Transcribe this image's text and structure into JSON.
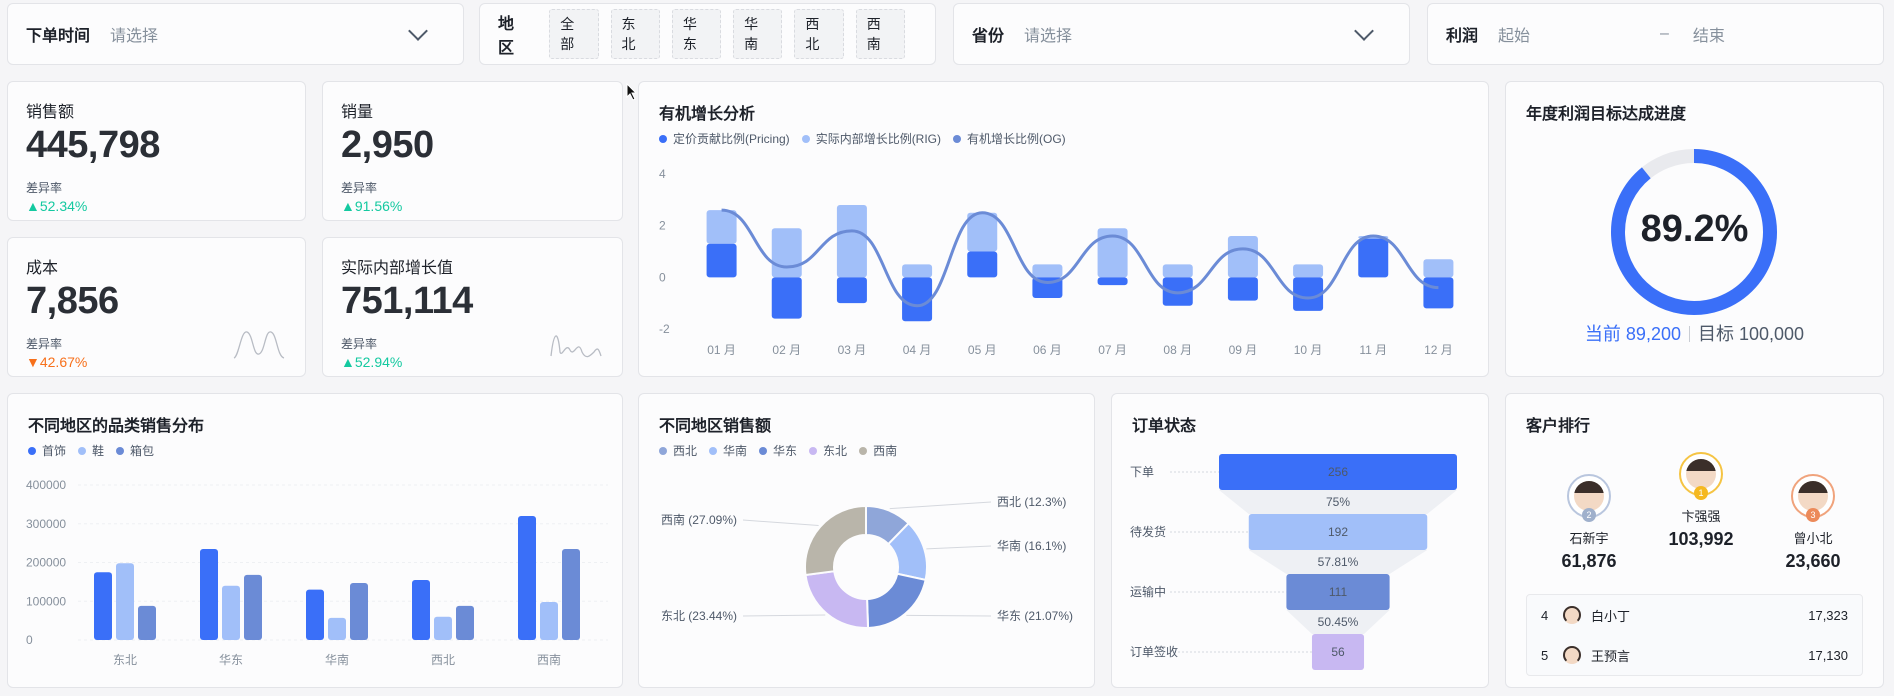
{
  "filters": {
    "order_time": {
      "label": "下单时间",
      "placeholder": "请选择"
    },
    "region": {
      "label": "地区",
      "tags": [
        "全部",
        "东北",
        "华东",
        "华南",
        "西北",
        "西南"
      ]
    },
    "province": {
      "label": "省份",
      "placeholder": "请选择"
    },
    "profit": {
      "label": "利润",
      "start": "起始",
      "sep": "–",
      "end": "结束"
    }
  },
  "kpis": [
    {
      "title": "销售额",
      "value": "445,798",
      "diff_label": "差异率",
      "delta": "52.34%",
      "trend": "up"
    },
    {
      "title": "销量",
      "value": "2,950",
      "diff_label": "差异率",
      "delta": "91.56%",
      "trend": "up"
    },
    {
      "title": "成本",
      "value": "7,856",
      "diff_label": "差异率",
      "delta": "42.67%",
      "trend": "down"
    },
    {
      "title": "实际内部增长值",
      "value": "751,114",
      "diff_label": "差异率",
      "delta": "52.94%",
      "trend": "up"
    }
  ],
  "colors": {
    "blue": "#3a6ff8",
    "light_blue": "#a1bff9",
    "slate_blue": "#6b8bd6",
    "lavender": "#c8b8f2",
    "gray": "#b9b5aa"
  },
  "growth": {
    "title": "有机增长分析",
    "legend": [
      {
        "label": "定价贡献比例(Pricing)",
        "color": "#3a6ff8"
      },
      {
        "label": "实际内部增长比例(RIG)",
        "color": "#a1bff9"
      },
      {
        "label": "有机增长比例(OG)",
        "color": "#6b8bd6"
      }
    ]
  },
  "gauge": {
    "title": "年度利润目标达成进度",
    "percent_text": "89.2%",
    "progress": 0.892,
    "current": "当前 89,200",
    "target": "目标 100,000"
  },
  "category": {
    "title": "不同地区的品类销售分布",
    "legend": [
      {
        "label": "首饰",
        "color": "#3a6ff8"
      },
      {
        "label": "鞋",
        "color": "#a1bff9"
      },
      {
        "label": "箱包",
        "color": "#6b8bd6"
      }
    ]
  },
  "region_sales": {
    "title": "不同地区销售额",
    "legend": [
      {
        "label": "西北",
        "color": "#8fa6d9"
      },
      {
        "label": "华南",
        "color": "#a1bff9"
      },
      {
        "label": "华东",
        "color": "#6b8bd6"
      },
      {
        "label": "东北",
        "color": "#c8b8f2"
      },
      {
        "label": "西南",
        "color": "#b9b5aa"
      }
    ]
  },
  "order_status": {
    "title": "订单状态"
  },
  "customers": {
    "title": "客户排行",
    "podium": [
      {
        "rank": "2",
        "name": "石新宇",
        "value": "61,876"
      },
      {
        "rank": "1",
        "name": "卞强强",
        "value": "103,992"
      },
      {
        "rank": "3",
        "name": "曾小北",
        "value": "23,660"
      }
    ],
    "list": [
      {
        "rank": "4",
        "name": "白小丁",
        "value": "17,323"
      },
      {
        "rank": "5",
        "name": "王预言",
        "value": "17,130"
      }
    ]
  },
  "chart_data": [
    {
      "type": "bar",
      "title": "有机增长分析",
      "categories": [
        "01 月",
        "02 月",
        "03 月",
        "04 月",
        "05 月",
        "06 月",
        "07 月",
        "08 月",
        "09 月",
        "10 月",
        "11 月",
        "12 月"
      ],
      "ylim": [
        -2,
        4
      ],
      "yticks": [
        "4",
        "2",
        "0",
        "-2"
      ],
      "series": [
        {
          "name": "定价贡献比例(Pricing)",
          "values": [
            1.3,
            -1.6,
            -1.0,
            -1.7,
            1.0,
            -0.8,
            -0.3,
            -1.1,
            -0.9,
            -1.3,
            1.5,
            -1.2
          ]
        },
        {
          "name": "实际内部增长比例(RIG)",
          "values": [
            1.3,
            1.9,
            2.8,
            0.5,
            1.5,
            0.5,
            1.9,
            0.5,
            1.6,
            0.5,
            0.1,
            0.7
          ]
        },
        {
          "name": "有机增长比例(OG)",
          "values": [
            2.6,
            0.4,
            1.8,
            -1.1,
            2.5,
            -0.2,
            1.6,
            -0.6,
            1.1,
            -0.8,
            1.6,
            -0.4
          ]
        }
      ]
    },
    {
      "type": "bar",
      "title": "不同地区的品类销售分布",
      "categories": [
        "东北",
        "华东",
        "华南",
        "西北",
        "西南"
      ],
      "ylim": [
        0,
        400000
      ],
      "yticks": [
        "400000",
        "300000",
        "200000",
        "100000",
        "0"
      ],
      "series": [
        {
          "name": "首饰",
          "values": [
            175000,
            235000,
            130000,
            155000,
            320000
          ]
        },
        {
          "name": "鞋",
          "values": [
            198000,
            140000,
            57000,
            60000,
            98000
          ]
        },
        {
          "name": "箱包",
          "values": [
            88000,
            168000,
            147000,
            88000,
            235000
          ]
        }
      ]
    },
    {
      "type": "pie",
      "title": "不同地区销售额",
      "series": [
        {
          "name": "西北",
          "value": 12.3,
          "label": "西北 (12.3%)"
        },
        {
          "name": "华南",
          "value": 16.1,
          "label": "华南 (16.1%)"
        },
        {
          "name": "华东",
          "value": 21.07,
          "label": "华东 (21.07%)"
        },
        {
          "name": "东北",
          "value": 23.44,
          "label": "东北 (23.44%)"
        },
        {
          "name": "西南",
          "value": 27.09,
          "label": "西南 (27.09%)"
        }
      ]
    },
    {
      "type": "bar",
      "title": "订单状态",
      "categories": [
        "下单",
        "待发货",
        "运输中",
        "订单签收"
      ],
      "values": [
        256,
        192,
        111,
        56
      ],
      "conversion": [
        "75%",
        "57.81%",
        "50.45%"
      ]
    }
  ]
}
